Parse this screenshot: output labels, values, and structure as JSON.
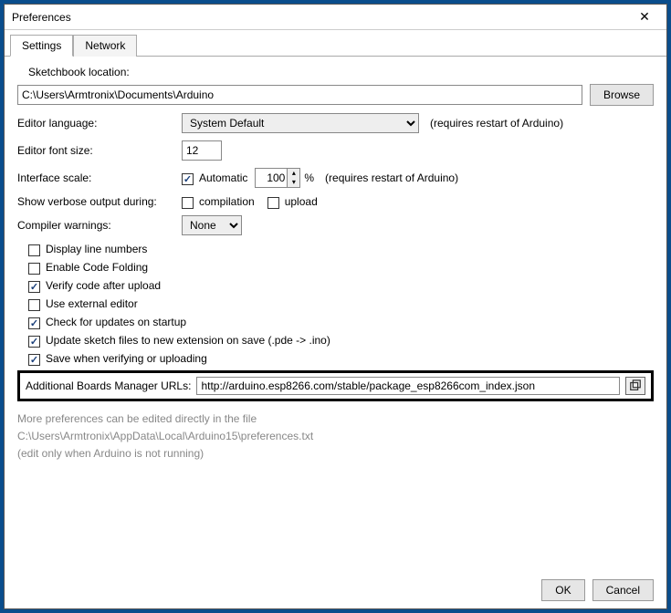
{
  "window": {
    "title": "Preferences"
  },
  "tabs": {
    "settings": "Settings",
    "network": "Network"
  },
  "sketchbook": {
    "label": "Sketchbook location:",
    "value": "C:\\Users\\Armtronix\\Documents\\Arduino",
    "browse": "Browse"
  },
  "language": {
    "label": "Editor language:",
    "value": "System Default",
    "note": "(requires restart of Arduino)"
  },
  "fontsize": {
    "label": "Editor font size:",
    "value": "12"
  },
  "scale": {
    "label": "Interface scale:",
    "automatic_label": "Automatic",
    "automatic_checked": true,
    "value": "100",
    "percent": "%",
    "note": "(requires restart of Arduino)"
  },
  "verbose": {
    "label": "Show verbose output during:",
    "compilation_label": "compilation",
    "compilation_checked": false,
    "upload_label": "upload",
    "upload_checked": false
  },
  "warnings": {
    "label": "Compiler warnings:",
    "value": "None"
  },
  "options": [
    {
      "label": "Display line numbers",
      "checked": false
    },
    {
      "label": "Enable Code Folding",
      "checked": false
    },
    {
      "label": "Verify code after upload",
      "checked": true
    },
    {
      "label": "Use external editor",
      "checked": false
    },
    {
      "label": "Check for updates on startup",
      "checked": true
    },
    {
      "label": "Update sketch files to new extension on save (.pde -> .ino)",
      "checked": true
    },
    {
      "label": "Save when verifying or uploading",
      "checked": true
    }
  ],
  "boards": {
    "label": "Additional Boards Manager URLs:",
    "value": "http://arduino.esp8266.com/stable/package_esp8266com_index.json"
  },
  "more": {
    "line1": "More preferences can be edited directly in the file",
    "path": "C:\\Users\\Armtronix\\AppData\\Local\\Arduino15\\preferences.txt",
    "line2": "(edit only when Arduino is not running)"
  },
  "buttons": {
    "ok": "OK",
    "cancel": "Cancel"
  }
}
